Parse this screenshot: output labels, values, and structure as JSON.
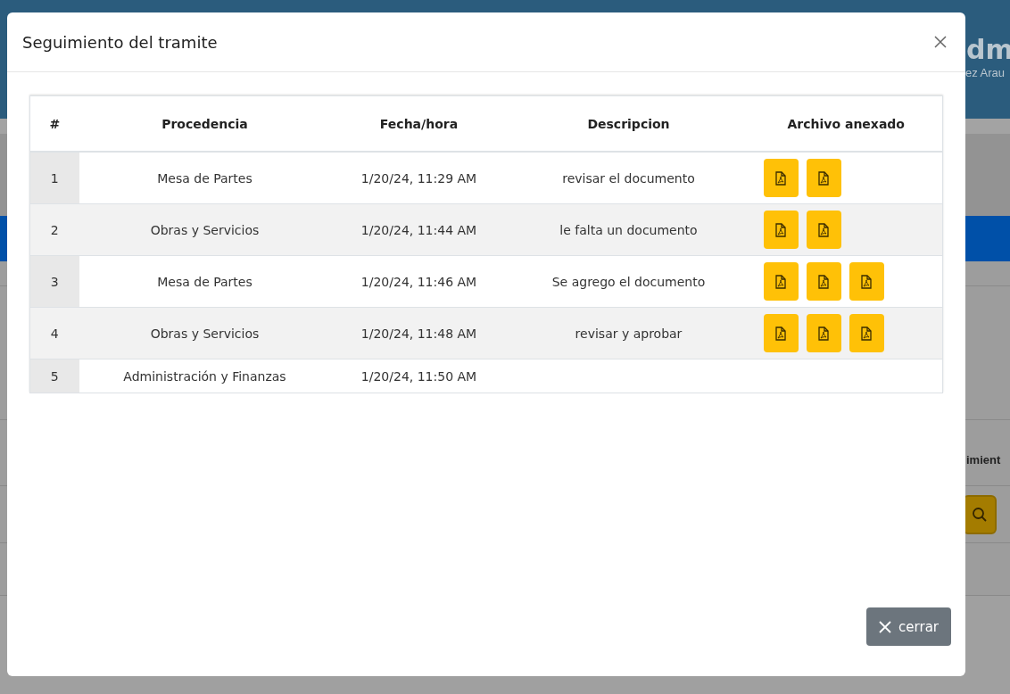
{
  "background": {
    "header_title": "dm",
    "header_subtitle": "ez Arau",
    "column_heading": "imient"
  },
  "modal": {
    "title": "Seguimiento del tramite",
    "columns": [
      "#",
      "Procedencia",
      "Fecha/hora",
      "Descripcion",
      "Archivo anexado"
    ],
    "rows": [
      {
        "index": "1",
        "origin": "Mesa de Partes",
        "datetime": "1/20/24, 11:29 AM",
        "description": "revisar el documento",
        "attachments": [
          {
            "kind": "pdf"
          },
          {
            "kind": "pdf"
          }
        ]
      },
      {
        "index": "2",
        "origin": "Obras y Servicios",
        "datetime": "1/20/24, 11:44 AM",
        "description": "le falta un documento",
        "attachments": [
          {
            "kind": "pdf"
          },
          {
            "kind": "pdf"
          }
        ]
      },
      {
        "index": "3",
        "origin": "Mesa de Partes",
        "datetime": "1/20/24, 11:46 AM",
        "description": "Se agrego el documento",
        "attachments": [
          {
            "kind": "pdf"
          },
          {
            "kind": "pdf"
          },
          {
            "kind": "pdf"
          }
        ]
      },
      {
        "index": "4",
        "origin": "Obras y Servicios",
        "datetime": "1/20/24, 11:48 AM",
        "description": "revisar y aprobar",
        "attachments": [
          {
            "kind": "pdf"
          },
          {
            "kind": "pdf"
          },
          {
            "kind": "pdf"
          }
        ]
      },
      {
        "index": "5",
        "origin": "Administración y Finanzas",
        "datetime": "1/20/24, 11:50 AM"
      }
    ],
    "close_button": "cerrar"
  }
}
